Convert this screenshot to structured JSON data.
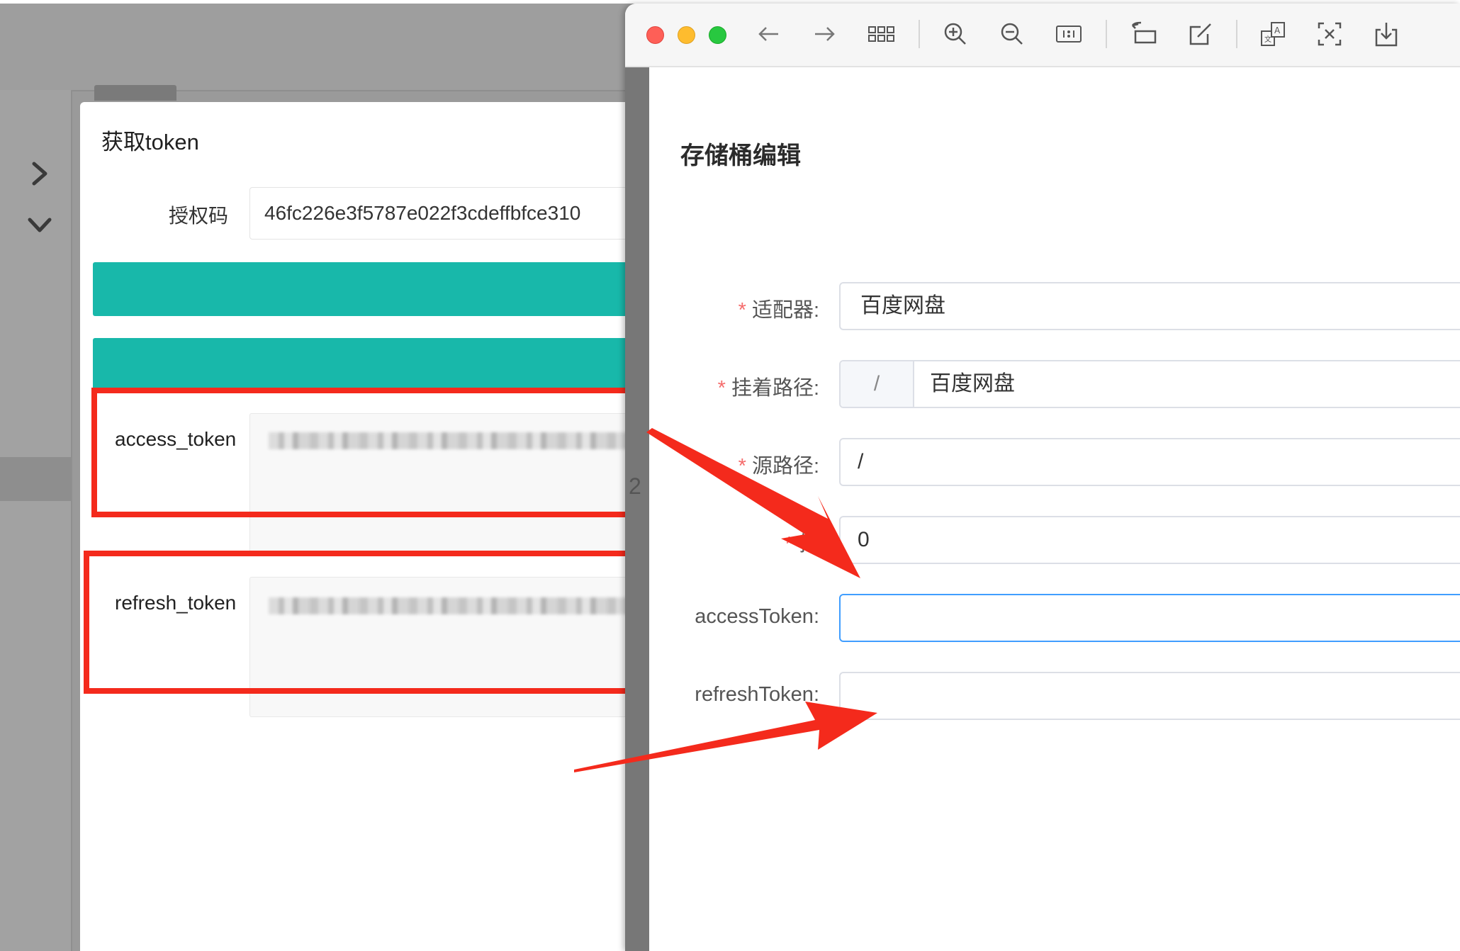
{
  "token_modal": {
    "title": "获取token",
    "auth_code_label": "授权码",
    "auth_code_value": "46fc226e3f5787e022f3cdeffbfce310",
    "access_token_label": "access_token",
    "refresh_token_label": "refresh_token"
  },
  "background": {
    "stray_text": "2"
  },
  "viewer": {
    "toolbar_icons": [
      "back-icon",
      "forward-icon",
      "thumbnails-icon",
      "zoom-in-icon",
      "zoom-out-icon",
      "actual-size-icon",
      "rotate-icon",
      "markup-icon",
      "translate-icon",
      "crop-icon",
      "share-icon"
    ]
  },
  "form": {
    "title": "存储桶编辑",
    "fields": {
      "adapter": {
        "label": "适配器:",
        "required": true,
        "value": "百度网盘"
      },
      "mount_path": {
        "label": "挂着路径:",
        "required": true,
        "prefix": "/",
        "value": "百度网盘"
      },
      "source_path": {
        "label": "源路径:",
        "required": true,
        "value": "/"
      },
      "sort": {
        "label": "排",
        "required": true,
        "value": "0"
      },
      "access_token": {
        "label": "accessToken:",
        "required": false,
        "value": ""
      },
      "refresh_token": {
        "label": "refreshToken:",
        "required": false,
        "value": ""
      }
    },
    "required_mark": "*"
  },
  "colors": {
    "teal": "#18b8aa",
    "annotation_red": "#f42a1c",
    "focus_blue": "#409eff",
    "required_red": "#f56c6c"
  }
}
